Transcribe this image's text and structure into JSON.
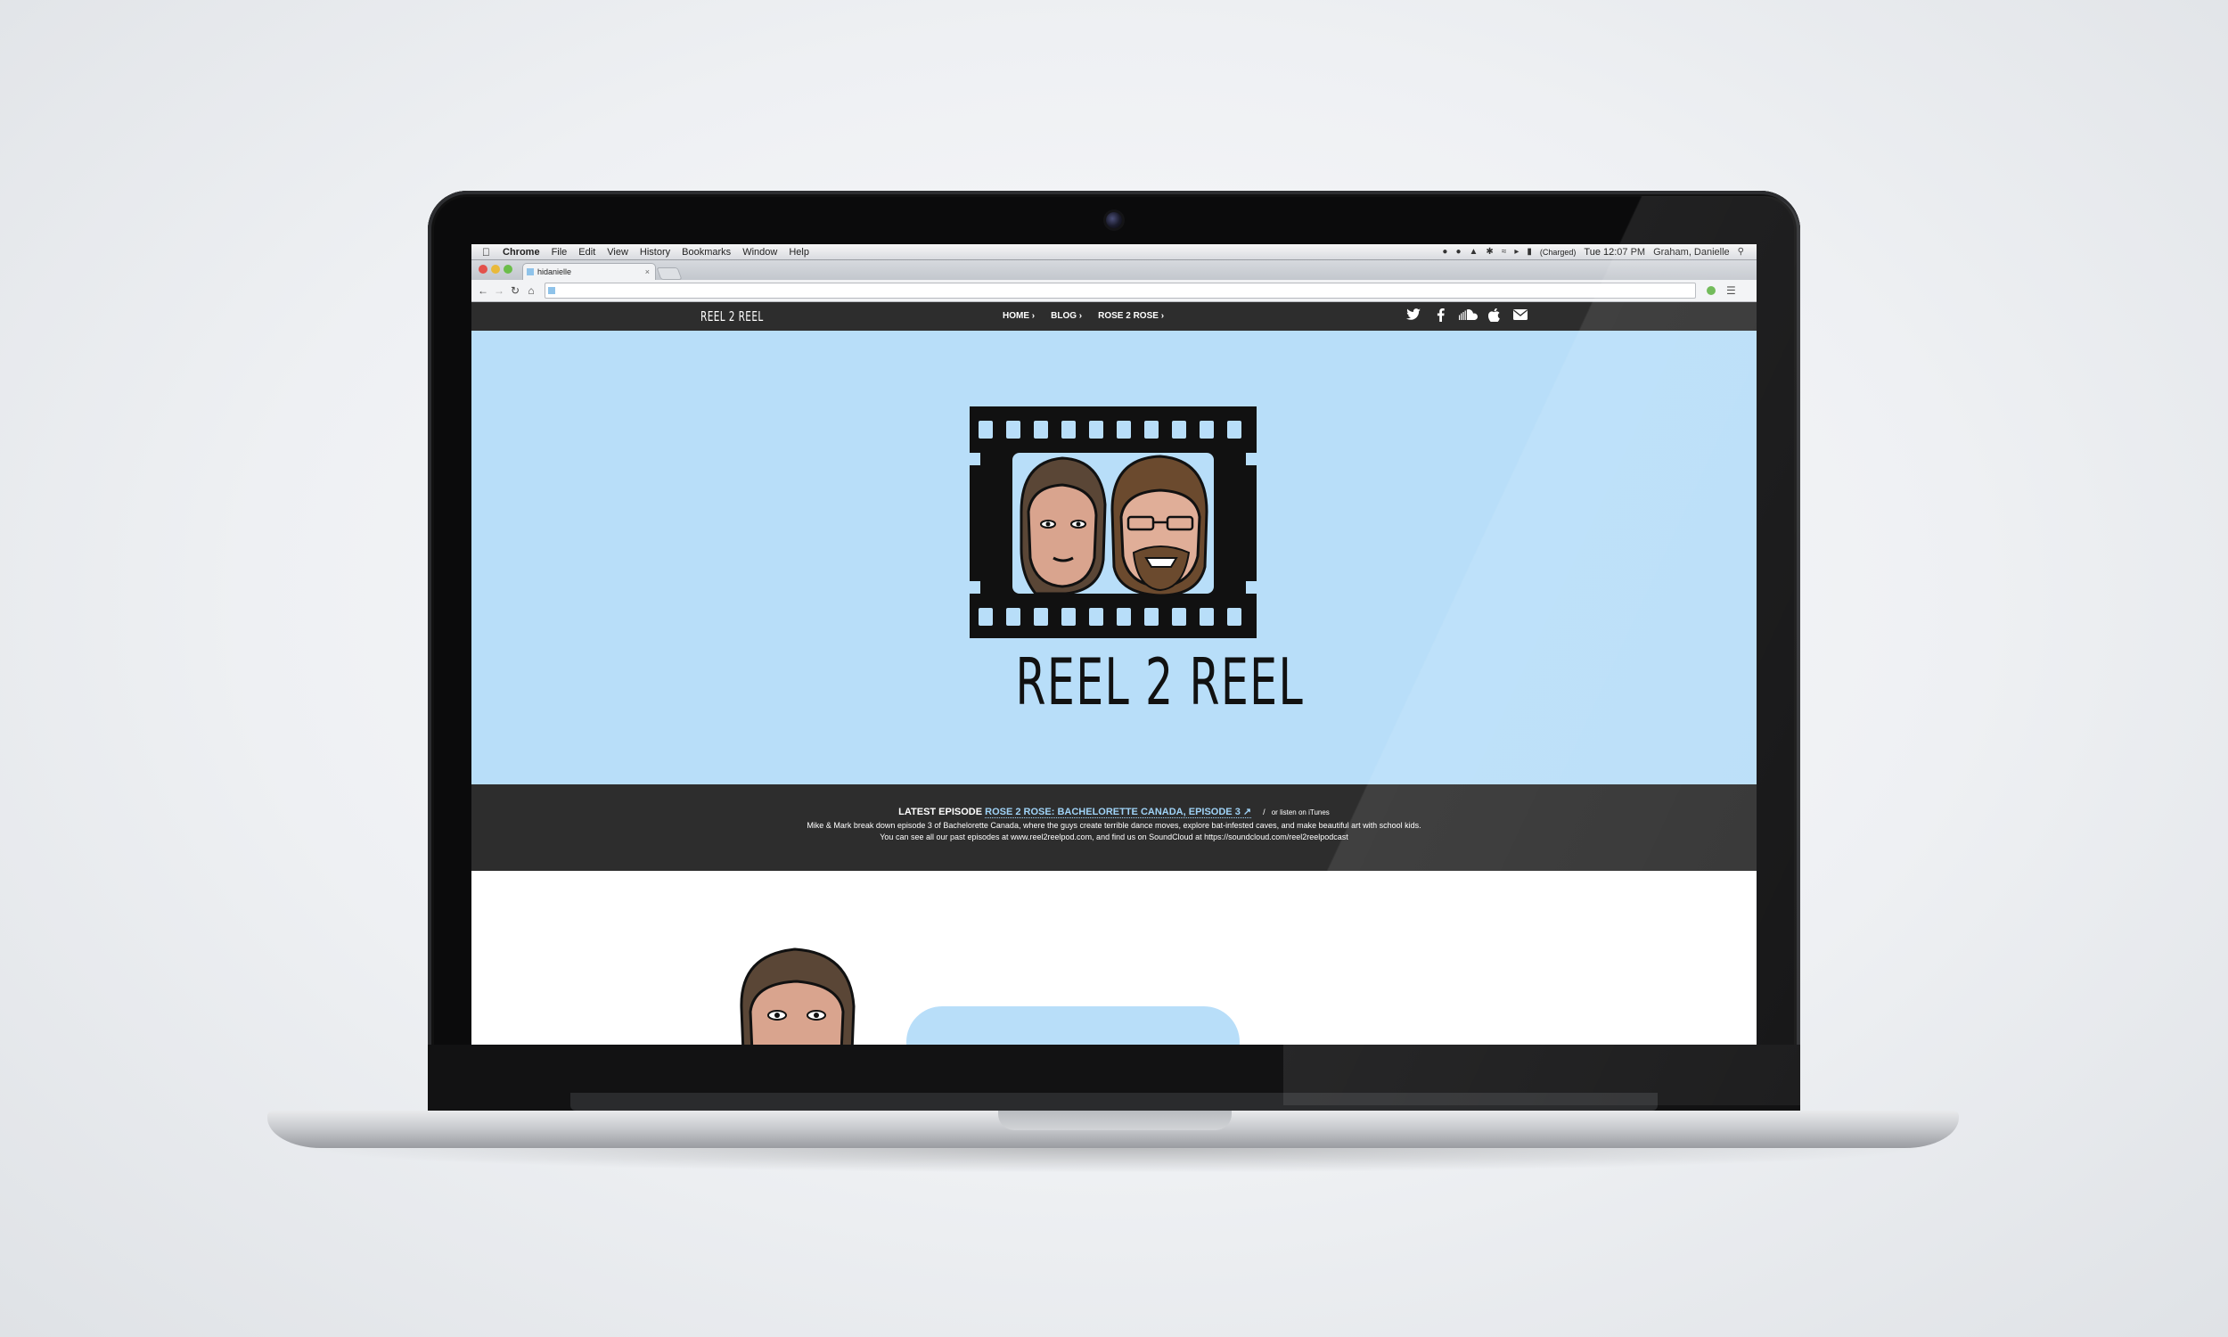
{
  "menubar": {
    "apple_icon": "apple-icon",
    "items": [
      "Chrome",
      "File",
      "Edit",
      "View",
      "History",
      "Bookmarks",
      "Window",
      "Help"
    ],
    "battery_status": "(Charged)",
    "clock": "Tue 12:07 PM",
    "user": "Graham, Danielle"
  },
  "browser": {
    "tab_title": "hidanielle",
    "url": ""
  },
  "site": {
    "brand": "REEL 2 REEL",
    "nav": [
      "HOME",
      "BLOG",
      "ROSE 2 ROSE"
    ],
    "social_icons": [
      "twitter-icon",
      "facebook-icon",
      "soundcloud-icon",
      "apple-icon",
      "email-icon"
    ],
    "logo_text": "REEL 2 REEL",
    "colors": {
      "hero_bg": "#b8def9",
      "nav_bg": "#2d2d2d",
      "link": "#9fd2f6"
    }
  },
  "episode": {
    "label": "LATEST EPISODE",
    "title": "ROSE 2 ROSE: BACHELORETTE CANADA, EPISODE 3",
    "separator": "/",
    "itunes": "or listen on iTunes",
    "description": "Mike & Mark break down episode 3 of Bachelorette Canada, where the guys create terrible dance moves, explore bat-infested caves, and make beautiful art with school kids.",
    "more": "You can see all our past episodes at www.reel2reelpod.com, and find us on SoundCloud at https://soundcloud.com/reel2reelpodcast"
  }
}
